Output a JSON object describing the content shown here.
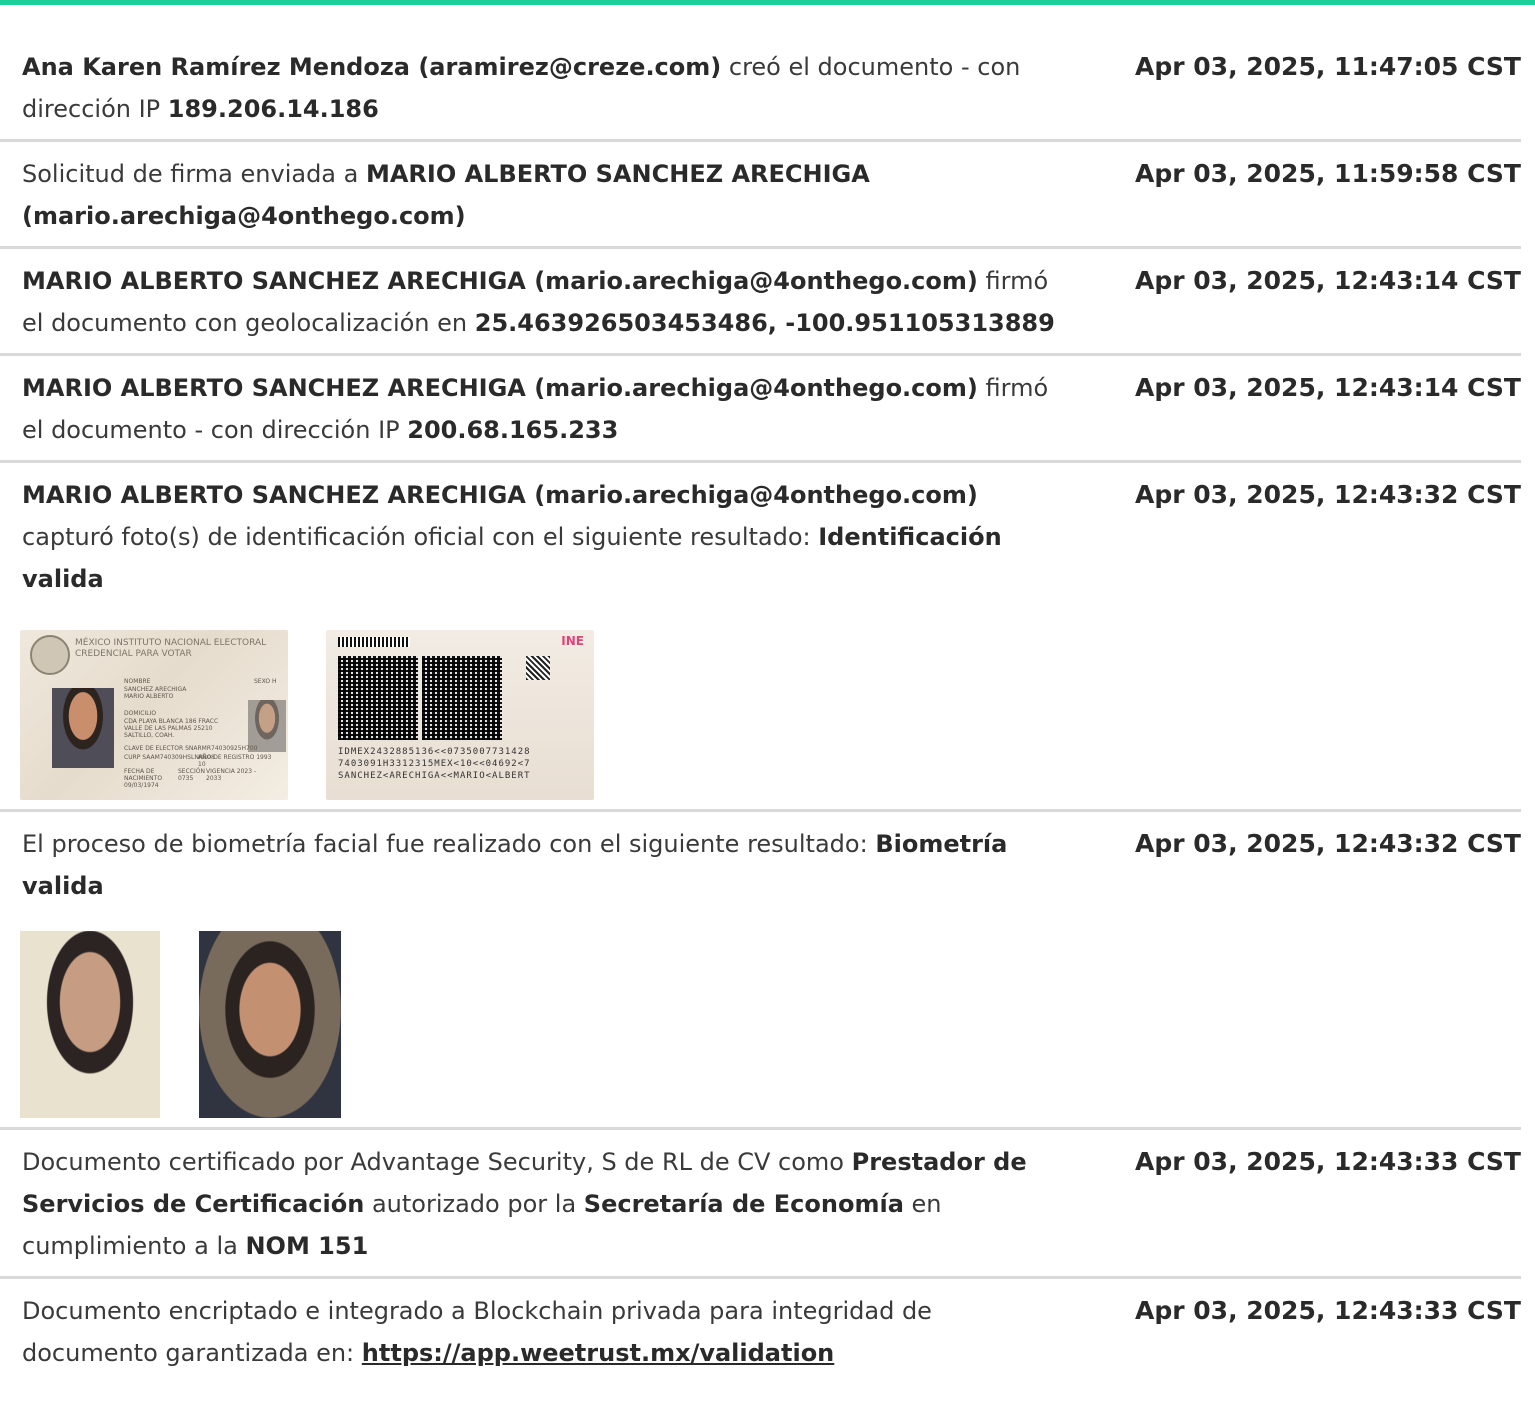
{
  "entries": [
    {
      "ts": "Apr 03, 2025, 11:47:05 CST",
      "parts": [
        "Ana Karen Ramírez Mendoza (aramirez@creze.com)",
        " creó el documento - con dirección IP ",
        "189.206.14.186"
      ]
    },
    {
      "ts": "Apr 03, 2025, 11:59:58 CST",
      "parts": [
        "Solicitud de firma enviada a ",
        "MARIO ALBERTO SANCHEZ ARECHIGA (mario.arechiga@4onthego.com)"
      ]
    },
    {
      "ts": "Apr 03, 2025, 12:43:14 CST",
      "parts": [
        "MARIO ALBERTO SANCHEZ ARECHIGA (mario.arechiga@4onthego.com)",
        " firmó el documento con geolocalización en ",
        "25.463926503453486, -100.951105313889"
      ]
    },
    {
      "ts": "Apr 03, 2025, 12:43:14 CST",
      "parts": [
        "MARIO ALBERTO SANCHEZ ARECHIGA (mario.arechiga@4onthego.com)",
        " firmó el documento - con dirección IP ",
        "200.68.165.233"
      ]
    },
    {
      "ts": "Apr 03, 2025, 12:43:32 CST",
      "parts": [
        "MARIO ALBERTO SANCHEZ ARECHIGA (mario.arechiga@4onthego.com)",
        " capturó foto(s) de identificación oficial con el siguiente resultado: ",
        "Identificación valida"
      ],
      "id_card": {
        "country": "MÉXICO",
        "institute": "INSTITUTO NACIONAL ELECTORAL",
        "credential": "CREDENCIAL PARA VOTAR",
        "name_label": "NOMBRE",
        "name": "SANCHEZ ARECHIGA MARIO ALBERTO",
        "sex": "SEXO H",
        "address_label": "DOMICILIO",
        "address": "CDA PLAYA BLANCA 186 FRACC VALLE DE LAS PALMAS 25210 SALTILLO, COAH.",
        "elector_key": "CLAVE DE ELECTOR SNARMR74030925H700",
        "curp": "CURP SAAM740309HSLNRR08",
        "registry": "AÑO DE REGISTRO 1993 10",
        "birth": "FECHA DE NACIMIENTO 09/03/1974",
        "section": "SECCIÓN 0735",
        "validity": "VIGENCIA 2023 - 2033",
        "back_brand": "INE",
        "mrz": [
          "IDMEX2432885136<<0735007731428",
          "7403091H3312315MEX<10<<04692<7",
          "SANCHEZ<ARECHIGA<<MARIO<ALBERT"
        ]
      }
    },
    {
      "ts": "Apr 03, 2025, 12:43:32 CST",
      "parts": [
        "El proceso de biometría facial fue realizado con el siguiente resultado: ",
        "Biometría valida"
      ]
    },
    {
      "ts": "Apr 03, 2025, 12:43:33 CST",
      "parts": [
        "Documento certificado por Advantage Security, S de RL de CV como ",
        "Prestador de Servicios de Certificación",
        " autorizado por la ",
        "Secretaría de Economía",
        " en cumplimiento a la ",
        "NOM 151"
      ]
    },
    {
      "ts": "Apr 03, 2025, 12:43:33 CST",
      "parts": [
        "Documento encriptado e integrado a Blockchain privada para integridad de documento garantizada en: ",
        "https://app.weetrust.mx/validation"
      ]
    }
  ],
  "colors": {
    "accent_bar": "#1fcf9b",
    "divider": "#d9d9d9",
    "text": "#3a3a3a"
  }
}
